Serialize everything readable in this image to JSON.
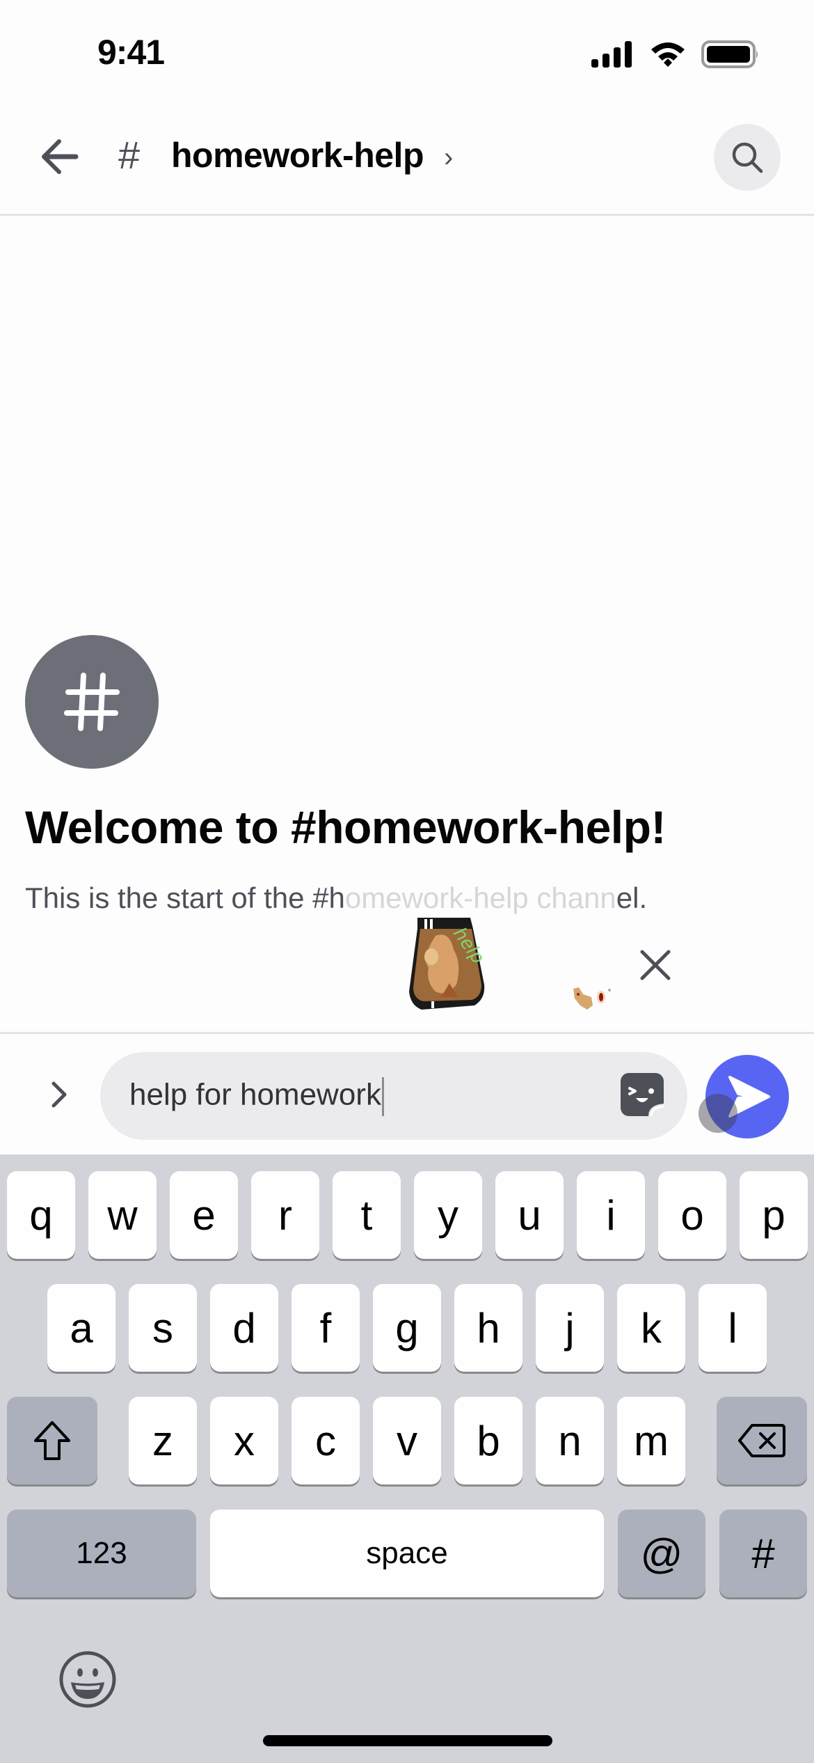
{
  "status_bar": {
    "time": "9:41",
    "icons": [
      "cellular-signal-icon",
      "wifi-icon",
      "battery-icon"
    ]
  },
  "header": {
    "back_icon": "arrow-left-icon",
    "channel_prefix": "#",
    "channel_name": "homework-help",
    "chevron": "›",
    "search_icon": "search-icon"
  },
  "welcome": {
    "avatar_symbol": "#",
    "title": "Welcome to #homework-help!",
    "desc_start": "This is the start of the #h",
    "desc_faded": "omework-help chann",
    "desc_end": "el."
  },
  "sticker_suggestion": {
    "sticker_label": "help",
    "close_icon": "close-icon"
  },
  "composer": {
    "expand_icon": "chevron-right-icon",
    "input_value": "help for homework",
    "sticker_icon": "sticker-icon",
    "send_icon": "send-icon",
    "accent_color": "#5865f2"
  },
  "keyboard": {
    "row1": [
      "q",
      "w",
      "e",
      "r",
      "t",
      "y",
      "u",
      "i",
      "o",
      "p"
    ],
    "row2": [
      "a",
      "s",
      "d",
      "f",
      "g",
      "h",
      "j",
      "k",
      "l"
    ],
    "row3": [
      "z",
      "x",
      "c",
      "v",
      "b",
      "n",
      "m"
    ],
    "shift_icon": "shift-icon",
    "delete_icon": "backspace-icon",
    "numbers_label": "123",
    "space_label": "space",
    "at_label": "@",
    "hash_label": "#",
    "emoji_icon": "emoji-icon"
  }
}
